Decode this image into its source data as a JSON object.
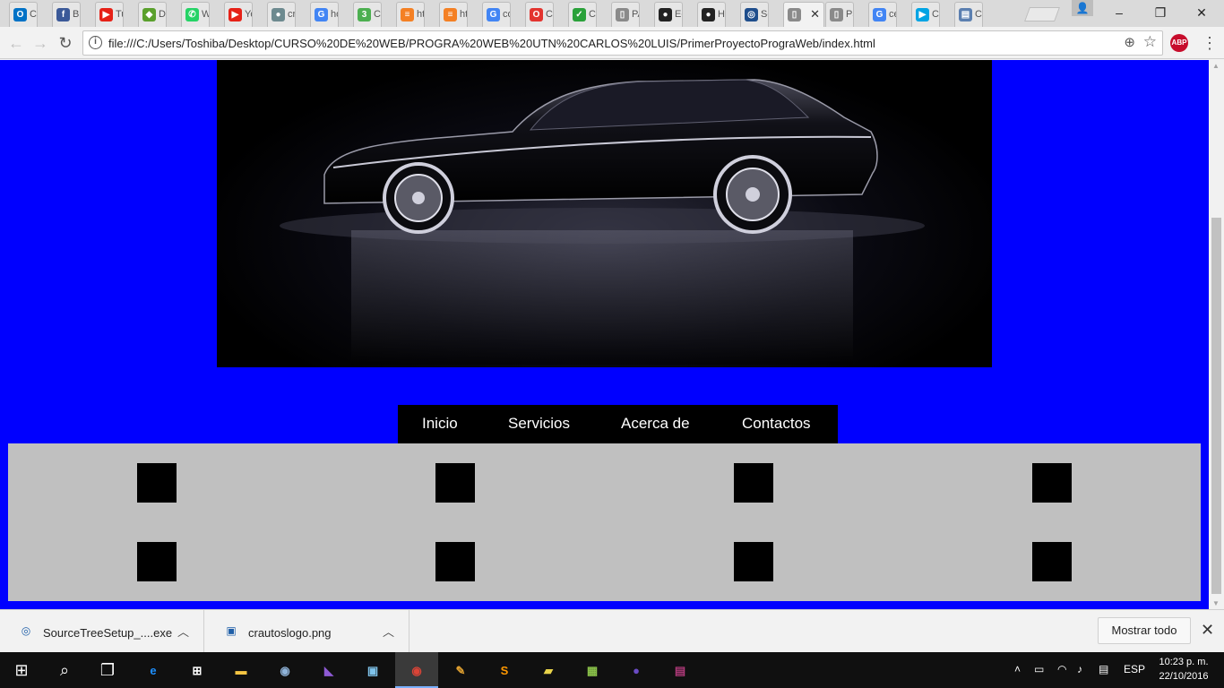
{
  "browser": {
    "tabs": [
      {
        "title": "Co",
        "icon": "outlook-icon",
        "color": "#0072c6",
        "glyph": "O"
      },
      {
        "title": "B",
        "icon": "facebook-icon",
        "color": "#3b5998",
        "glyph": "f"
      },
      {
        "title": "Tu",
        "icon": "youtube-icon",
        "color": "#e62117",
        "glyph": "▶"
      },
      {
        "title": "Di",
        "icon": "green-shape-icon",
        "color": "#5aa02c",
        "glyph": "◆"
      },
      {
        "title": "W",
        "icon": "whatsapp-icon",
        "color": "#25d366",
        "glyph": "✆"
      },
      {
        "title": "Yo",
        "icon": "youtube-icon",
        "color": "#e62117",
        "glyph": "▶"
      },
      {
        "title": "cr",
        "icon": "car-icon",
        "color": "#6d8a8f",
        "glyph": "●"
      },
      {
        "title": "ho",
        "icon": "google-icon",
        "color": "#4285f4",
        "glyph": "G"
      },
      {
        "title": "C",
        "icon": "css3-icon",
        "color": "#4caf50",
        "glyph": "3"
      },
      {
        "title": "ht",
        "icon": "stackoverflow-icon",
        "color": "#f48024",
        "glyph": "≡"
      },
      {
        "title": "ht",
        "icon": "stackoverflow-icon",
        "color": "#f48024",
        "glyph": "≡"
      },
      {
        "title": "co",
        "icon": "google-icon",
        "color": "#4285f4",
        "glyph": "G"
      },
      {
        "title": "Co",
        "icon": "opera-icon",
        "color": "#e3342f",
        "glyph": "O"
      },
      {
        "title": "Co",
        "icon": "checkmark-icon",
        "color": "#2aa13a",
        "glyph": "✓"
      },
      {
        "title": "PA",
        "icon": "document-icon",
        "color": "#8a8a8a",
        "glyph": "▯"
      },
      {
        "title": "Ec",
        "icon": "github-icon",
        "color": "#222222",
        "glyph": "●"
      },
      {
        "title": "H",
        "icon": "github-icon",
        "color": "#222222",
        "glyph": "●"
      },
      {
        "title": "Sc",
        "icon": "sourcetree-icon",
        "color": "#1f4e8c",
        "glyph": "◎"
      },
      {
        "title": "",
        "icon": "document-icon",
        "color": "#8a8a8a",
        "glyph": "▯",
        "active": true
      },
      {
        "title": "Pa",
        "icon": "document-icon",
        "color": "#8a8a8a",
        "glyph": "▯"
      },
      {
        "title": "ce",
        "icon": "google-icon",
        "color": "#4285f4",
        "glyph": "G"
      },
      {
        "title": "Co",
        "icon": "play-store-icon",
        "color": "#00a4e4",
        "glyph": "▶"
      },
      {
        "title": "Co",
        "icon": "settings-page-icon",
        "color": "#5b7fb0",
        "glyph": "▤"
      }
    ],
    "address": "file:///C:/Users/Toshiba/Desktop/CURSO%20DE%20WEB/PROGRA%20WEB%20UTN%20CARLOS%20LUIS/PrimerProyectoPrograWeb/index.html",
    "extension_label": "ABP"
  },
  "page": {
    "background_color": "#0000ff",
    "nav": {
      "items": [
        "Inicio",
        "Servicios",
        "Acerca de",
        "Contactos"
      ]
    }
  },
  "downloads": {
    "items": [
      {
        "name": "SourceTreeSetup_....exe",
        "icon": "sourcetree-icon"
      },
      {
        "name": "crautoslogo.png",
        "icon": "image-file-icon"
      }
    ],
    "show_all": "Mostrar todo"
  },
  "taskbar": {
    "apps": [
      {
        "name": "internet-explorer-edge-icon",
        "glyph": "e",
        "color": "#1e90ff"
      },
      {
        "name": "store-icon",
        "glyph": "⊞",
        "color": "#ffffff"
      },
      {
        "name": "file-explorer-icon",
        "glyph": "▬",
        "color": "#f5c542"
      },
      {
        "name": "postgresql-icon",
        "glyph": "◉",
        "color": "#8fb3d9"
      },
      {
        "name": "visual-studio-icon",
        "glyph": "◣",
        "color": "#8e5ad4"
      },
      {
        "name": "virtualbox-icon",
        "glyph": "▣",
        "color": "#7fc3ea"
      },
      {
        "name": "chrome-icon",
        "glyph": "◉",
        "color": "#db4437"
      },
      {
        "name": "paint-icon",
        "glyph": "✎",
        "color": "#e0a030"
      },
      {
        "name": "sublime-text-icon",
        "glyph": "S",
        "color": "#ff9800"
      },
      {
        "name": "folder-app-icon",
        "glyph": "▰",
        "color": "#e8d34a"
      },
      {
        "name": "notepad-plus-icon",
        "glyph": "▦",
        "color": "#8bc34a"
      },
      {
        "name": "purple-app-icon",
        "glyph": "●",
        "color": "#6a4bc4"
      },
      {
        "name": "winrar-icon",
        "glyph": "▤",
        "color": "#b03a7a"
      }
    ],
    "language": "ESP",
    "time": "10:23 p. m.",
    "date": "22/10/2016"
  }
}
